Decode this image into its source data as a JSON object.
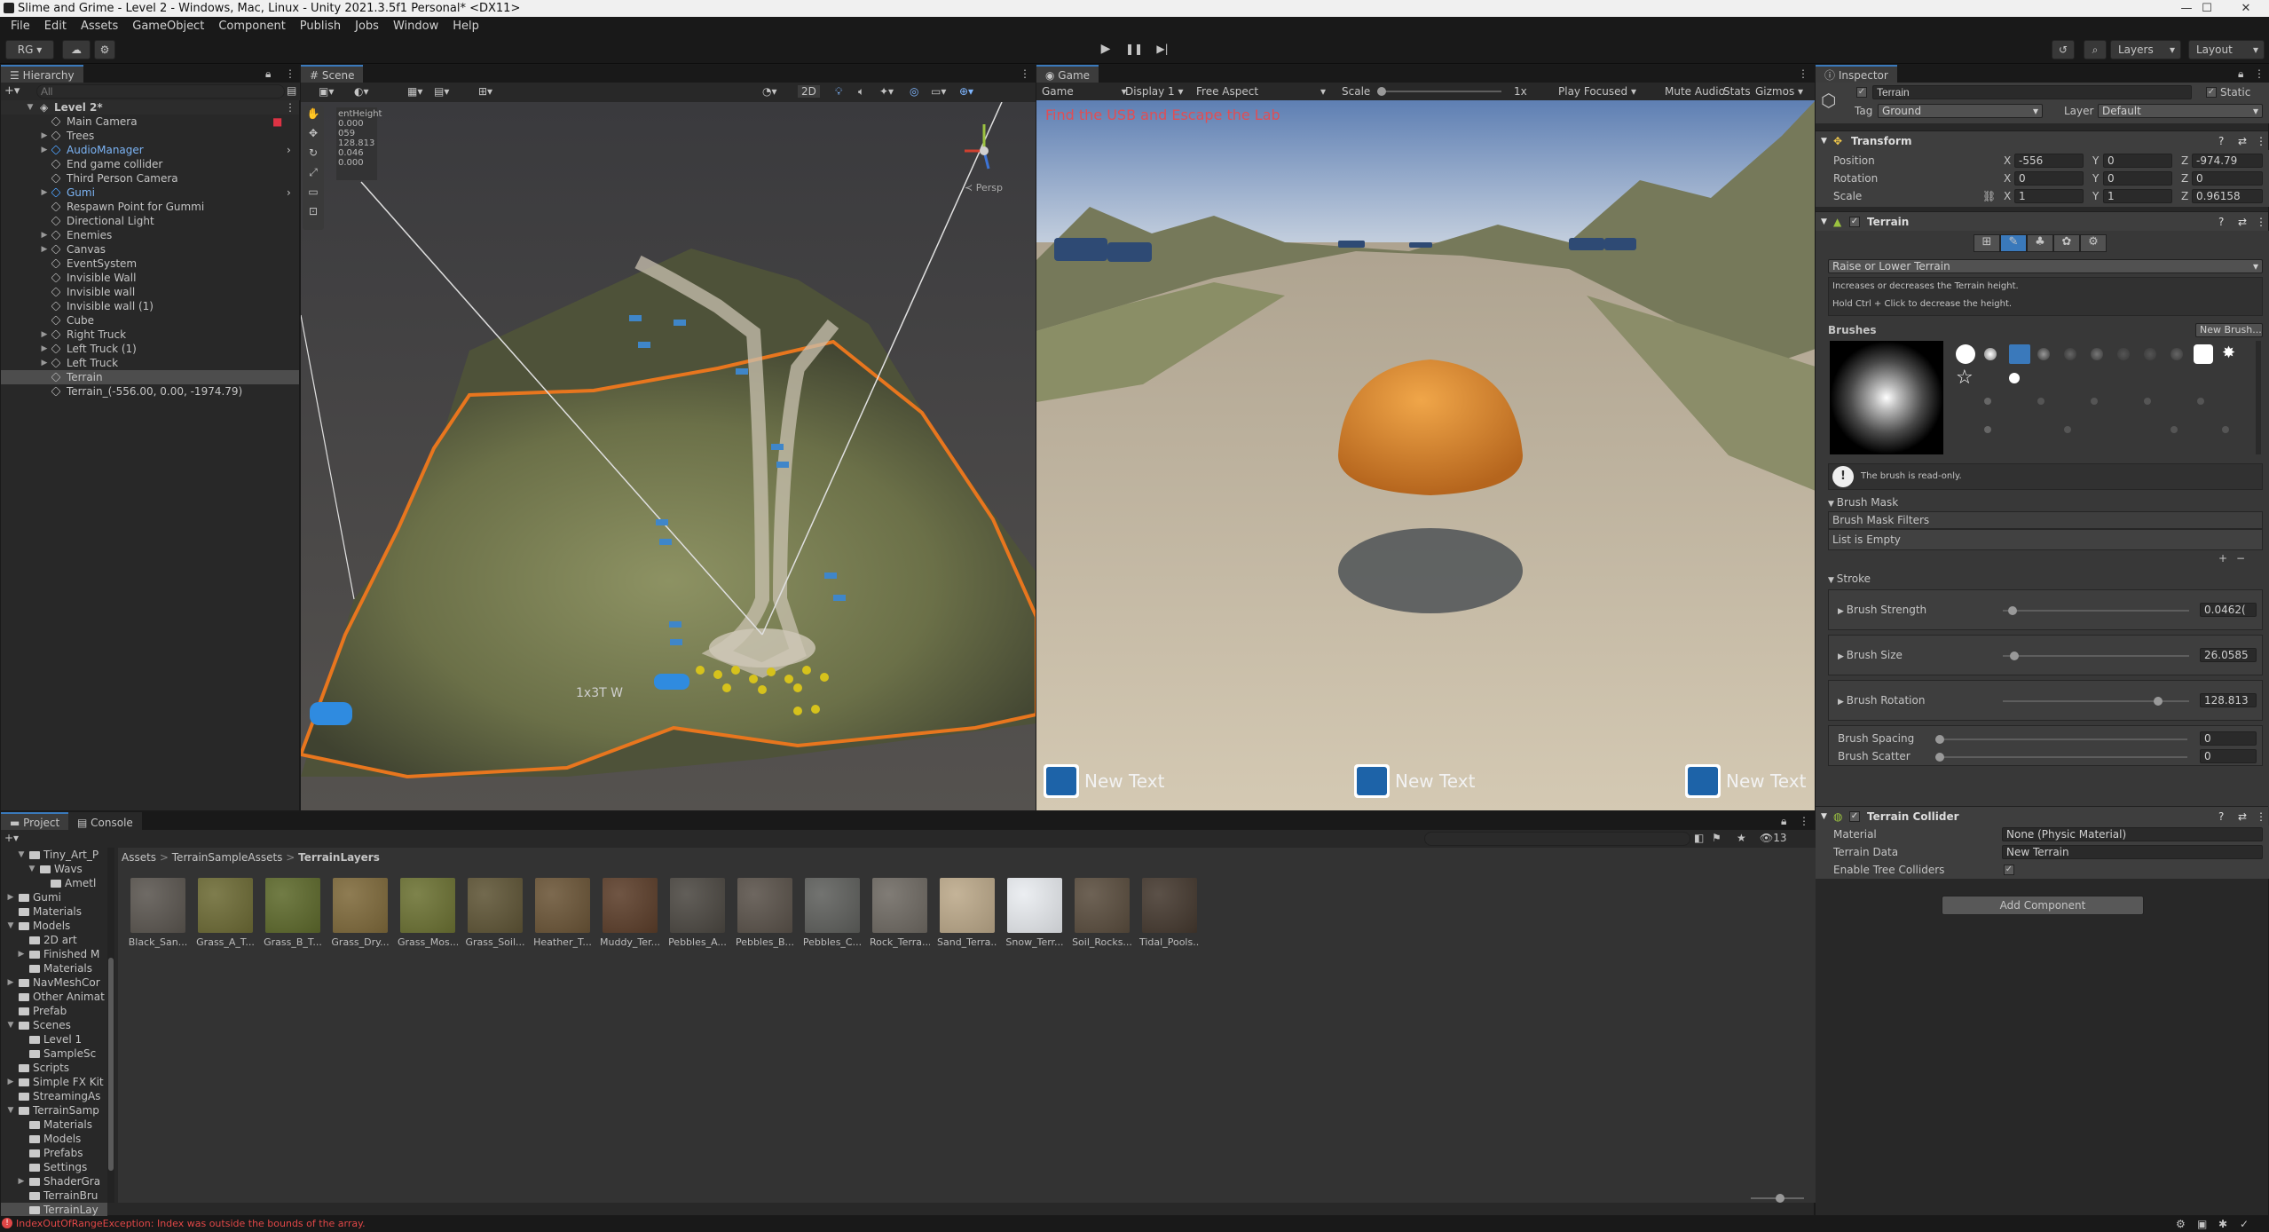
{
  "window": {
    "title": "Slime and Grime - Level 2 - Windows, Mac, Linux - Unity 2021.3.5f1 Personal* <DX11>",
    "minimize": "—",
    "maximize": "☐",
    "close": "✕"
  },
  "menu": [
    "File",
    "Edit",
    "Assets",
    "GameObject",
    "Component",
    "Publish",
    "Jobs",
    "Window",
    "Help"
  ],
  "toolbar": {
    "account": "RG",
    "layers": "Layers",
    "layout": "Layout"
  },
  "hierarchy": {
    "tab": "Hierarchy",
    "search_placeholder": "All",
    "scene": "Level 2*",
    "items": [
      {
        "label": "Main Camera",
        "depth": 1,
        "arrow": "",
        "icon": "cube"
      },
      {
        "label": "Trees",
        "depth": 1,
        "arrow": "▶",
        "icon": "cube"
      },
      {
        "label": "AudioManager",
        "depth": 1,
        "arrow": "▶",
        "icon": "prefab"
      },
      {
        "label": "End game collider",
        "depth": 1,
        "arrow": "",
        "icon": "cube"
      },
      {
        "label": "Third Person Camera",
        "depth": 1,
        "arrow": "",
        "icon": "cube"
      },
      {
        "label": "Gumi",
        "depth": 1,
        "arrow": "▶",
        "icon": "prefab"
      },
      {
        "label": "Respawn Point for Gummi",
        "depth": 1,
        "arrow": "",
        "icon": "cube"
      },
      {
        "label": "Directional Light",
        "depth": 1,
        "arrow": "",
        "icon": "cube"
      },
      {
        "label": "Enemies",
        "depth": 1,
        "arrow": "▶",
        "icon": "cube"
      },
      {
        "label": "Canvas",
        "depth": 1,
        "arrow": "▶",
        "icon": "cube"
      },
      {
        "label": "EventSystem",
        "depth": 1,
        "arrow": "",
        "icon": "cube"
      },
      {
        "label": "Invisible Wall",
        "depth": 1,
        "arrow": "",
        "icon": "cube"
      },
      {
        "label": "Invisible wall",
        "depth": 1,
        "arrow": "",
        "icon": "cube"
      },
      {
        "label": "Invisible wall (1)",
        "depth": 1,
        "arrow": "",
        "icon": "cube"
      },
      {
        "label": "Cube",
        "depth": 1,
        "arrow": "",
        "icon": "cube"
      },
      {
        "label": "Right Truck",
        "depth": 1,
        "arrow": "▶",
        "icon": "cube"
      },
      {
        "label": "Left Truck (1)",
        "depth": 1,
        "arrow": "▶",
        "icon": "cube"
      },
      {
        "label": "Left Truck",
        "depth": 1,
        "arrow": "▶",
        "icon": "cube"
      },
      {
        "label": "Terrain",
        "depth": 1,
        "arrow": "",
        "icon": "cube"
      },
      {
        "label": "Terrain_(-556.00, 0.00, -1974.79)",
        "depth": 1,
        "arrow": "",
        "icon": "cube"
      }
    ]
  },
  "scene": {
    "tab": "Scene",
    "mode_2d": "2D",
    "persp": "≺ Persp",
    "overlay_title": "entHeight",
    "overlay_values": [
      "0.000",
      "059",
      "128.813",
      "0.046",
      "0.000"
    ],
    "label_text": "1x3T W"
  },
  "game": {
    "tab": "Game",
    "view": "Game",
    "display": "Display 1",
    "aspect": "Free Aspect",
    "scale_label": "Scale",
    "scale_value": "1x",
    "play_mode": "Play Focused",
    "mute": "Mute Audio",
    "stats": "Stats",
    "gizmos": "Gizmos",
    "objective": "Find the USB and Escape the Lab",
    "ui_texts": [
      "New Text",
      "New Text",
      "New Text"
    ]
  },
  "inspector": {
    "tab": "Inspector",
    "object_name": "Terrain",
    "static_label": "Static",
    "tag_label": "Tag",
    "tag_value": "Ground",
    "layer_label": "Layer",
    "layer_value": "Default",
    "transform": {
      "title": "Transform",
      "position_label": "Position",
      "rotation_label": "Rotation",
      "scale_label": "Scale",
      "pos": {
        "x": "-556",
        "y": "0",
        "z": "-974.79"
      },
      "rot": {
        "x": "0",
        "y": "0",
        "z": "0"
      },
      "scl": {
        "x": "1",
        "y": "1",
        "z": "0.96158"
      }
    },
    "terrain": {
      "title": "Terrain",
      "tool": "Raise or Lower Terrain",
      "help1": "Increases or decreases the Terrain height.",
      "help2": "Hold Ctrl + Click to decrease the height.",
      "brushes_label": "Brushes",
      "new_brush": "New Brush...",
      "readonly": "The brush is read-only.",
      "brush_mask": "Brush Mask",
      "brush_mask_filters": "Brush Mask Filters",
      "list_empty": "List is Empty",
      "stroke": "Stroke",
      "strength_label": "Brush Strength",
      "strength_value": "0.0462(",
      "strength_level": 0.03,
      "size_label": "Brush Size",
      "size_value": "26.0585",
      "size_level": 0.04,
      "rotation_label": "Brush Rotation",
      "rotation_value": "128.813",
      "rotation_level": 0.85,
      "spacing_label": "Brush Spacing",
      "spacing_value": "0",
      "scatter_label": "Brush Scatter",
      "scatter_value": "0"
    },
    "collider": {
      "title": "Terrain Collider",
      "material_label": "Material",
      "material_value": "None (Physic Material)",
      "data_label": "Terrain Data",
      "data_value": "New Terrain",
      "trees_label": "Enable Tree Colliders"
    },
    "add_component": "Add Component"
  },
  "project": {
    "tab_project": "Project",
    "tab_console": "Console",
    "hidden_count": "13",
    "breadcrumb": [
      "Assets",
      "TerrainSampleAssets",
      "TerrainLayers"
    ],
    "tree": [
      {
        "label": "Tiny_Art_P",
        "depth": 1,
        "arrow": "▼"
      },
      {
        "label": "Wavs",
        "depth": 2,
        "arrow": "▼"
      },
      {
        "label": "Ametl",
        "depth": 3,
        "arrow": ""
      },
      {
        "label": "Gumi",
        "depth": 0,
        "arrow": "▶"
      },
      {
        "label": "Materials",
        "depth": 0,
        "arrow": ""
      },
      {
        "label": "Models",
        "depth": 0,
        "arrow": "▼"
      },
      {
        "label": "2D art",
        "depth": 1,
        "arrow": ""
      },
      {
        "label": "Finished M",
        "depth": 1,
        "arrow": "▶"
      },
      {
        "label": "Materials",
        "depth": 1,
        "arrow": ""
      },
      {
        "label": "NavMeshCor",
        "depth": 0,
        "arrow": "▶"
      },
      {
        "label": "Other Animat",
        "depth": 0,
        "arrow": ""
      },
      {
        "label": "Prefab",
        "depth": 0,
        "arrow": ""
      },
      {
        "label": "Scenes",
        "depth": 0,
        "arrow": "▼"
      },
      {
        "label": "Level 1",
        "depth": 1,
        "arrow": ""
      },
      {
        "label": "SampleSc",
        "depth": 1,
        "arrow": ""
      },
      {
        "label": "Scripts",
        "depth": 0,
        "arrow": ""
      },
      {
        "label": "Simple FX Kit",
        "depth": 0,
        "arrow": "▶"
      },
      {
        "label": "StreamingAs",
        "depth": 0,
        "arrow": ""
      },
      {
        "label": "TerrainSamp",
        "depth": 0,
        "arrow": "▼"
      },
      {
        "label": "Materials",
        "depth": 1,
        "arrow": ""
      },
      {
        "label": "Models",
        "depth": 1,
        "arrow": ""
      },
      {
        "label": "Prefabs",
        "depth": 1,
        "arrow": ""
      },
      {
        "label": "Settings",
        "depth": 1,
        "arrow": ""
      },
      {
        "label": "ShaderGra",
        "depth": 1,
        "arrow": "▶"
      },
      {
        "label": "TerrainBru",
        "depth": 1,
        "arrow": ""
      },
      {
        "label": "TerrainLay",
        "depth": 1,
        "arrow": ""
      }
    ],
    "assets": [
      {
        "label": "Black_San...",
        "color": "#5b5650"
      },
      {
        "label": "Grass_A_T...",
        "color": "#6d6b35"
      },
      {
        "label": "Grass_B_T...",
        "color": "#5e6a2c"
      },
      {
        "label": "Grass_Dry...",
        "color": "#7f6a3b"
      },
      {
        "label": "Grass_Mos...",
        "color": "#6c7233"
      },
      {
        "label": "Grass_Soil...",
        "color": "#5f5536"
      },
      {
        "label": "Heather_T...",
        "color": "#6b5537"
      },
      {
        "label": "Muddy_Ter...",
        "color": "#5c3e2a"
      },
      {
        "label": "Pebbles_A...",
        "color": "#4c4842"
      },
      {
        "label": "Pebbles_B...",
        "color": "#5a524a"
      },
      {
        "label": "Pebbles_C...",
        "color": "#5f605d"
      },
      {
        "label": "Rock_Terra...",
        "color": "#6f6a63"
      },
      {
        "label": "Sand_Terra...",
        "color": "#bca98a"
      },
      {
        "label": "Snow_Terr...",
        "color": "#e9ecf0"
      },
      {
        "label": "Soil_Rocks...",
        "color": "#5a4d3e"
      },
      {
        "label": "Tidal_Pools...",
        "color": "#45392f"
      }
    ]
  },
  "status": {
    "error": "IndexOutOfRangeException: Index was outside the bounds of the array."
  }
}
